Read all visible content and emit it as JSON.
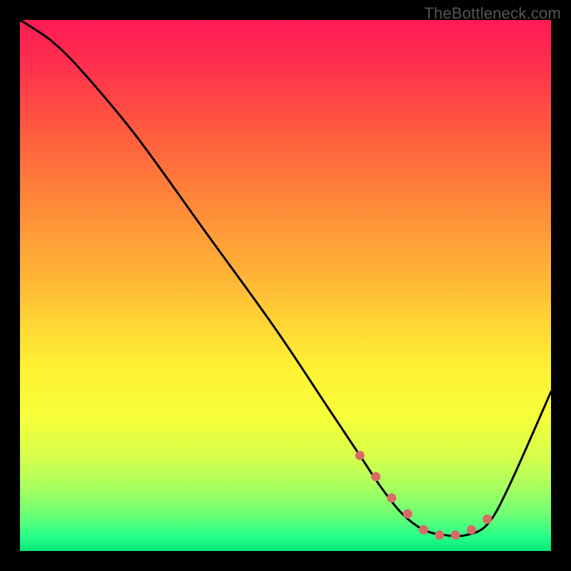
{
  "watermark": "TheBottleneck.com",
  "chart_data": {
    "type": "line",
    "title": "",
    "xlabel": "",
    "ylabel": "",
    "xlim": [
      0,
      100
    ],
    "ylim": [
      0,
      100
    ],
    "gradient_stops": [
      {
        "pct": 0,
        "color": "#ff1a56"
      },
      {
        "pct": 8,
        "color": "#ff2e4e"
      },
      {
        "pct": 20,
        "color": "#ff5840"
      },
      {
        "pct": 30,
        "color": "#ff7a3a"
      },
      {
        "pct": 40,
        "color": "#ff9a38"
      },
      {
        "pct": 50,
        "color": "#ffba36"
      },
      {
        "pct": 58,
        "color": "#ffd935"
      },
      {
        "pct": 66,
        "color": "#fff233"
      },
      {
        "pct": 75,
        "color": "#f5ff3a"
      },
      {
        "pct": 82,
        "color": "#d8ff4a"
      },
      {
        "pct": 88,
        "color": "#a8ff5e"
      },
      {
        "pct": 93,
        "color": "#6eff72"
      },
      {
        "pct": 97,
        "color": "#2bff88"
      },
      {
        "pct": 100,
        "color": "#04e87a"
      }
    ],
    "series": [
      {
        "name": "curve",
        "x": [
          0,
          6,
          12,
          22,
          35,
          48,
          58,
          64,
          68,
          72,
          76,
          80,
          84,
          88,
          92,
          100
        ],
        "y": [
          100,
          96,
          90,
          78,
          60,
          42,
          27,
          18,
          12,
          7,
          4,
          3,
          3,
          5,
          12,
          30
        ]
      }
    ],
    "markers": {
      "name": "highlight-dots",
      "color": "#d96a66",
      "x": [
        64,
        67,
        70,
        73,
        76,
        79,
        82,
        85,
        88
      ],
      "y": [
        18,
        14,
        10,
        7,
        4,
        3,
        3,
        4,
        6
      ]
    }
  }
}
